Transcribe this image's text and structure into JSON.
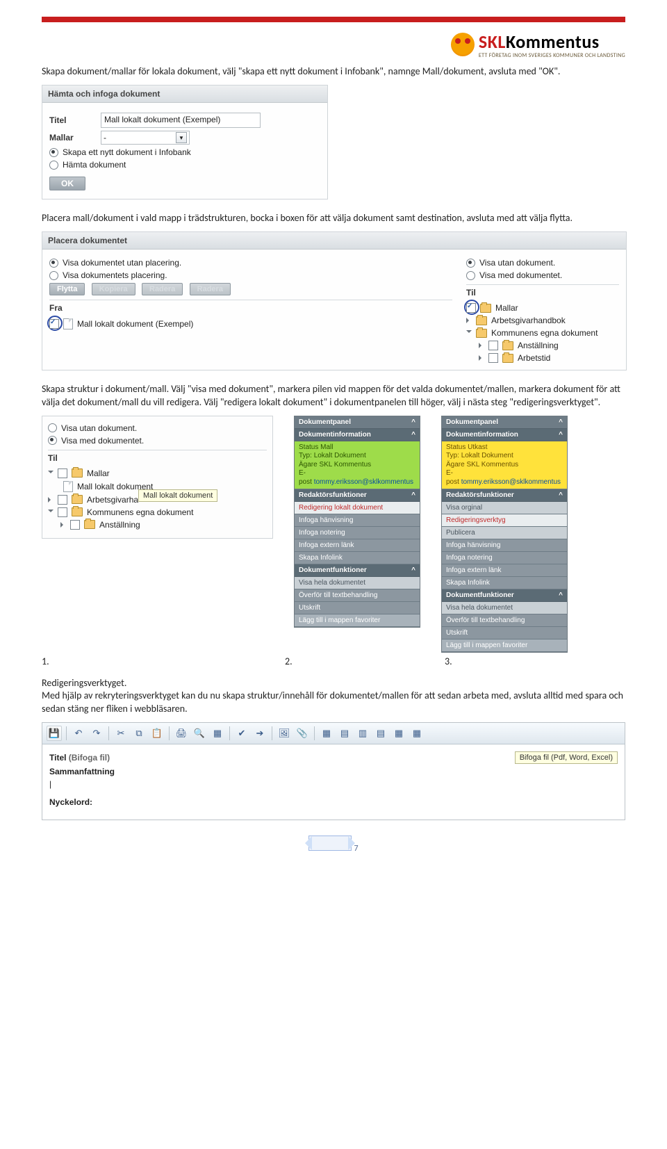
{
  "logo": {
    "brand_skl": "SKL",
    "brand_komm": "Kommentus",
    "tagline": "ETT FÖRETAG INOM SVERIGES KOMMUNER OCH LANDSTING"
  },
  "para1": "Skapa dokument/mallar för lokala dokument, välj \"skapa ett nytt dokument i Infobank\", namnge Mall/dokument, avsluta med \"OK\".",
  "ss1": {
    "title": "Hämta och infoga dokument",
    "titel_label": "Titel",
    "titel_value": "Mall lokalt dokument (Exempel)",
    "mallar_label": "Mallar",
    "mallar_value": "-",
    "opt_skapa": "Skapa ett nytt dokument i Infobank",
    "opt_hamta": "Hämta dokument",
    "ok": "OK"
  },
  "para2": "Placera mall/dokument i vald mapp i trädstrukturen, bocka i boxen för att välja dokument samt destination, avsluta med att välja flytta.",
  "ss2": {
    "title": "Placera dokumentet",
    "left_opt1": "Visa dokumentet utan placering.",
    "left_opt2": "Visa dokumentets placering.",
    "btn_flytta": "Flytta",
    "btn_kopiera": "Kopiera",
    "btn_radera": "Radera",
    "btn_radera2": "Radera",
    "fra_label": "Fra",
    "fra_item": "Mall lokalt dokument (Exempel)",
    "right_opt1": "Visa utan dokument.",
    "right_opt2": "Visa med dokumentet.",
    "til_label": "Til",
    "til_mallar": "Mallar",
    "til_arbgiv": "Arbetsgivarhandbok",
    "til_kommun": "Kommunens egna dokument",
    "til_anst": "Anställning",
    "til_arbtid": "Arbetstid"
  },
  "para3": "Skapa struktur i dokument/mall. Välj \"visa med dokument\", markera pilen vid mappen för det valda dokumentet/mallen, markera dokument för att välja det dokument/mall du vill redigera. Välj \"redigera lokalt dokument\" i dokumentpanelen till höger, välj i nästa steg \"redigeringsverktyget\".",
  "tilbox": {
    "opt1": "Visa utan dokument.",
    "opt2": "Visa med dokumentet.",
    "til_label": "Til",
    "mallar": "Mallar",
    "mall_lokalt": "Mall lokalt dokument",
    "tooltip": "Mall lokalt dokument",
    "arbgiv": "Arbetsgivarha",
    "kommun": "Kommunens egna dokument",
    "anst": "Anställning"
  },
  "panelA": {
    "head": "Dokumentpanel",
    "caret": "^",
    "sec_info": "Dokumentinformation",
    "status": "Status Mall",
    "typ_lbl": "Typ:",
    "typ_val": "Lokalt Dokument",
    "agare_lbl": "Ägare",
    "agare_val": "SKL Kommentus",
    "epost_lbl": "E-post",
    "epost_val": "tommy.eriksson@sklkommentus",
    "sec_redaktor": "Redaktörsfunktioner",
    "redigera_lokalt": "Redigering lokalt dokument",
    "infoga_hanv": "Infoga hänvisning",
    "infoga_not": "Infoga notering",
    "infoga_ext": "Infoga extern länk",
    "skapa_infolink": "Skapa Infolink",
    "sec_dokfunk": "Dokumentfunktioner",
    "visa_hela": "Visa hela dokumentet",
    "overfor": "Överför till textbehandling",
    "utskrift": "Utskrift",
    "lagg_fav": "Lägg till i mappen favoriter"
  },
  "panelB": {
    "head": "Dokumentpanel",
    "caret": "^",
    "sec_info": "Dokumentinformation",
    "status_lbl": "Status",
    "status_val": "Utkast",
    "typ_lbl": "Typ:",
    "typ_val": "Lokalt Dokument",
    "agare_lbl": "Ägare",
    "agare_val": "SKL Kommentus",
    "epost_lbl": "E-post",
    "epost_val": "tommy.eriksson@sklkommentus",
    "sec_redaktor": "Redaktörsfunktioner",
    "visa_original": "Visa orginal",
    "redverktyg": "Redigeringsverktyg",
    "publicera": "Publicera",
    "infoga_hanv": "Infoga hänvisning",
    "infoga_not": "Infoga notering",
    "infoga_ext": "Infoga extern länk",
    "skapa_infolink": "Skapa Infolink",
    "sec_dokfunk": "Dokumentfunktioner",
    "visa_hela": "Visa hela dokumentet",
    "overfor": "Överför till textbehandling",
    "utskrift": "Utskrift",
    "lagg_fav": "Lägg till i mappen favoriter"
  },
  "nums": {
    "one": "1.",
    "two": "2.",
    "three": "3."
  },
  "para4_head": "Redigeringsverktyget.",
  "para4": "Med hjälp av rekryteringsverktyget kan du nu skapa struktur/innehåll för dokumentet/mallen för att sedan arbeta med, avsluta alltid med spara och sedan stäng ner fliken i webbläsaren.",
  "editor": {
    "titel_lbl": "Titel",
    "titel_hint": "(Bifoga fil)",
    "bifoga_hint": "Bifoga fil (Pdf, Word, Excel)",
    "samman_lbl": "Sammanfattning",
    "cursor": "|",
    "nyckel_lbl": "Nyckelord:"
  },
  "page_num": "7"
}
